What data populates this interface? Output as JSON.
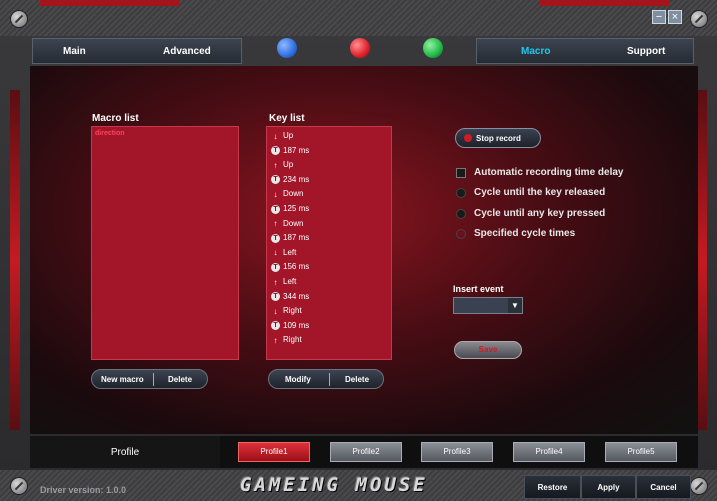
{
  "window": {
    "minimize_glyph": "−",
    "close_glyph": "×"
  },
  "nav": {
    "left_tabs": [
      {
        "label": "Main"
      },
      {
        "label": "Advanced"
      }
    ],
    "right_tabs": [
      {
        "label": "Macro",
        "active": true
      },
      {
        "label": "Support"
      }
    ],
    "leds": [
      "#2f6fe0",
      "#e0202a",
      "#1fb845"
    ],
    "active_color": "#1ec8f0"
  },
  "macro_list": {
    "title": "Macro list",
    "items": [
      "direction"
    ],
    "new_label": "New macro",
    "delete_label": "Delete"
  },
  "key_list": {
    "title": "Key list",
    "modify_label": "Modify",
    "delete_label": "Delete",
    "items": [
      {
        "icon": "down-arrow-icon",
        "glyph": "↓",
        "text": "Up"
      },
      {
        "icon": "timer-icon",
        "glyph": "T",
        "text": "187 ms"
      },
      {
        "icon": "up-arrow-icon",
        "glyph": "↑",
        "text": "Up"
      },
      {
        "icon": "timer-icon",
        "glyph": "T",
        "text": "234 ms"
      },
      {
        "icon": "down-arrow-icon",
        "glyph": "↓",
        "text": "Down"
      },
      {
        "icon": "timer-icon",
        "glyph": "T",
        "text": "125 ms"
      },
      {
        "icon": "up-arrow-icon",
        "glyph": "↑",
        "text": "Down"
      },
      {
        "icon": "timer-icon",
        "glyph": "T",
        "text": "187 ms"
      },
      {
        "icon": "down-arrow-icon",
        "glyph": "↓",
        "text": "Left"
      },
      {
        "icon": "timer-icon",
        "glyph": "T",
        "text": "156 ms"
      },
      {
        "icon": "up-arrow-icon",
        "glyph": "↑",
        "text": "Left"
      },
      {
        "icon": "timer-icon",
        "glyph": "T",
        "text": "344 ms"
      },
      {
        "icon": "down-arrow-icon",
        "glyph": "↓",
        "text": "Right"
      },
      {
        "icon": "timer-icon",
        "glyph": "T",
        "text": "109 ms"
      },
      {
        "icon": "up-arrow-icon",
        "glyph": "↑",
        "text": "Right"
      }
    ]
  },
  "record": {
    "stop_label": "Stop record",
    "options": [
      {
        "type": "checkbox",
        "label": "Automatic recording time delay"
      },
      {
        "type": "radio",
        "label": "Cycle until the key released"
      },
      {
        "type": "radio",
        "label": "Cycle until any key pressed"
      },
      {
        "type": "radio",
        "label": "Specified cycle times"
      }
    ],
    "insert_event_label": "Insert event",
    "insert_event_value": "",
    "save_label": "Save"
  },
  "profiles": {
    "label": "Profile",
    "items": [
      "Profile1",
      "Profile2",
      "Profile3",
      "Profile4",
      "Profile5"
    ],
    "active_index": 0
  },
  "footer": {
    "version": "Driver version: 1.0.0",
    "brand": "GAMEING MOUSE",
    "restore_label": "Restore",
    "apply_label": "Apply",
    "cancel_label": "Cancel"
  }
}
